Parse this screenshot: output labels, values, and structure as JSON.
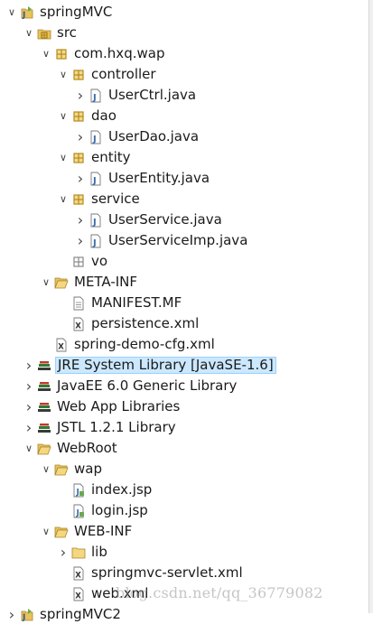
{
  "tree": [
    {
      "label": "springMVC",
      "indent": 0,
      "arrow": "expanded",
      "icon": "project-icon"
    },
    {
      "label": "src",
      "indent": 1,
      "arrow": "expanded",
      "icon": "source-folder-icon"
    },
    {
      "label": "com.hxq.wap",
      "indent": 2,
      "arrow": "expanded",
      "icon": "package-icon"
    },
    {
      "label": "controller",
      "indent": 3,
      "arrow": "expanded",
      "icon": "package-icon"
    },
    {
      "label": "UserCtrl.java",
      "indent": 4,
      "arrow": "collapsed",
      "icon": "java-file-icon"
    },
    {
      "label": "dao",
      "indent": 3,
      "arrow": "expanded",
      "icon": "package-icon"
    },
    {
      "label": "UserDao.java",
      "indent": 4,
      "arrow": "collapsed",
      "icon": "java-file-icon"
    },
    {
      "label": "entity",
      "indent": 3,
      "arrow": "expanded",
      "icon": "package-icon"
    },
    {
      "label": "UserEntity.java",
      "indent": 4,
      "arrow": "collapsed",
      "icon": "java-file-icon"
    },
    {
      "label": "service",
      "indent": 3,
      "arrow": "expanded",
      "icon": "package-icon"
    },
    {
      "label": "UserService.java",
      "indent": 4,
      "arrow": "collapsed",
      "icon": "java-file-icon"
    },
    {
      "label": "UserServiceImp.java",
      "indent": 4,
      "arrow": "collapsed",
      "icon": "java-file-icon"
    },
    {
      "label": "vo",
      "indent": 3,
      "arrow": "none",
      "icon": "empty-package-icon"
    },
    {
      "label": "META-INF",
      "indent": 2,
      "arrow": "expanded",
      "icon": "open-folder-icon"
    },
    {
      "label": "MANIFEST.MF",
      "indent": 3,
      "arrow": "none",
      "icon": "text-file-icon"
    },
    {
      "label": "persistence.xml",
      "indent": 3,
      "arrow": "none",
      "icon": "xml-file-icon"
    },
    {
      "label": "spring-demo-cfg.xml",
      "indent": 2,
      "arrow": "none",
      "icon": "xml-file-icon"
    },
    {
      "label": "JRE System Library [JavaSE-1.6]",
      "indent": 1,
      "arrow": "collapsed",
      "icon": "library-icon",
      "selected": true
    },
    {
      "label": "JavaEE 6.0 Generic Library",
      "indent": 1,
      "arrow": "collapsed",
      "icon": "library-icon"
    },
    {
      "label": "Web App Libraries",
      "indent": 1,
      "arrow": "collapsed",
      "icon": "library-icon"
    },
    {
      "label": "JSTL 1.2.1 Library",
      "indent": 1,
      "arrow": "collapsed",
      "icon": "library-icon"
    },
    {
      "label": "WebRoot",
      "indent": 1,
      "arrow": "expanded",
      "icon": "open-folder-icon"
    },
    {
      "label": "wap",
      "indent": 2,
      "arrow": "expanded",
      "icon": "open-folder-icon"
    },
    {
      "label": "index.jsp",
      "indent": 3,
      "arrow": "none",
      "icon": "jsp-file-icon"
    },
    {
      "label": "login.jsp",
      "indent": 3,
      "arrow": "none",
      "icon": "jsp-file-icon"
    },
    {
      "label": "WEB-INF",
      "indent": 2,
      "arrow": "expanded",
      "icon": "open-folder-icon"
    },
    {
      "label": "lib",
      "indent": 3,
      "arrow": "collapsed",
      "icon": "folder-icon"
    },
    {
      "label": "springmvc-servlet.xml",
      "indent": 3,
      "arrow": "none",
      "icon": "xml-file-icon"
    },
    {
      "label": "web.xml",
      "indent": 3,
      "arrow": "none",
      "icon": "xml-file-icon"
    },
    {
      "label": "springMVC2",
      "indent": 0,
      "arrow": "collapsed",
      "icon": "project-icon"
    }
  ],
  "watermark": "blog.csdn.net/qq_36779082",
  "colors": {
    "selection_bg": "#cce8ff",
    "package_gold": "#b48a1e",
    "folder_yellow": "#e8c25a",
    "java_blue": "#3b6db3"
  }
}
